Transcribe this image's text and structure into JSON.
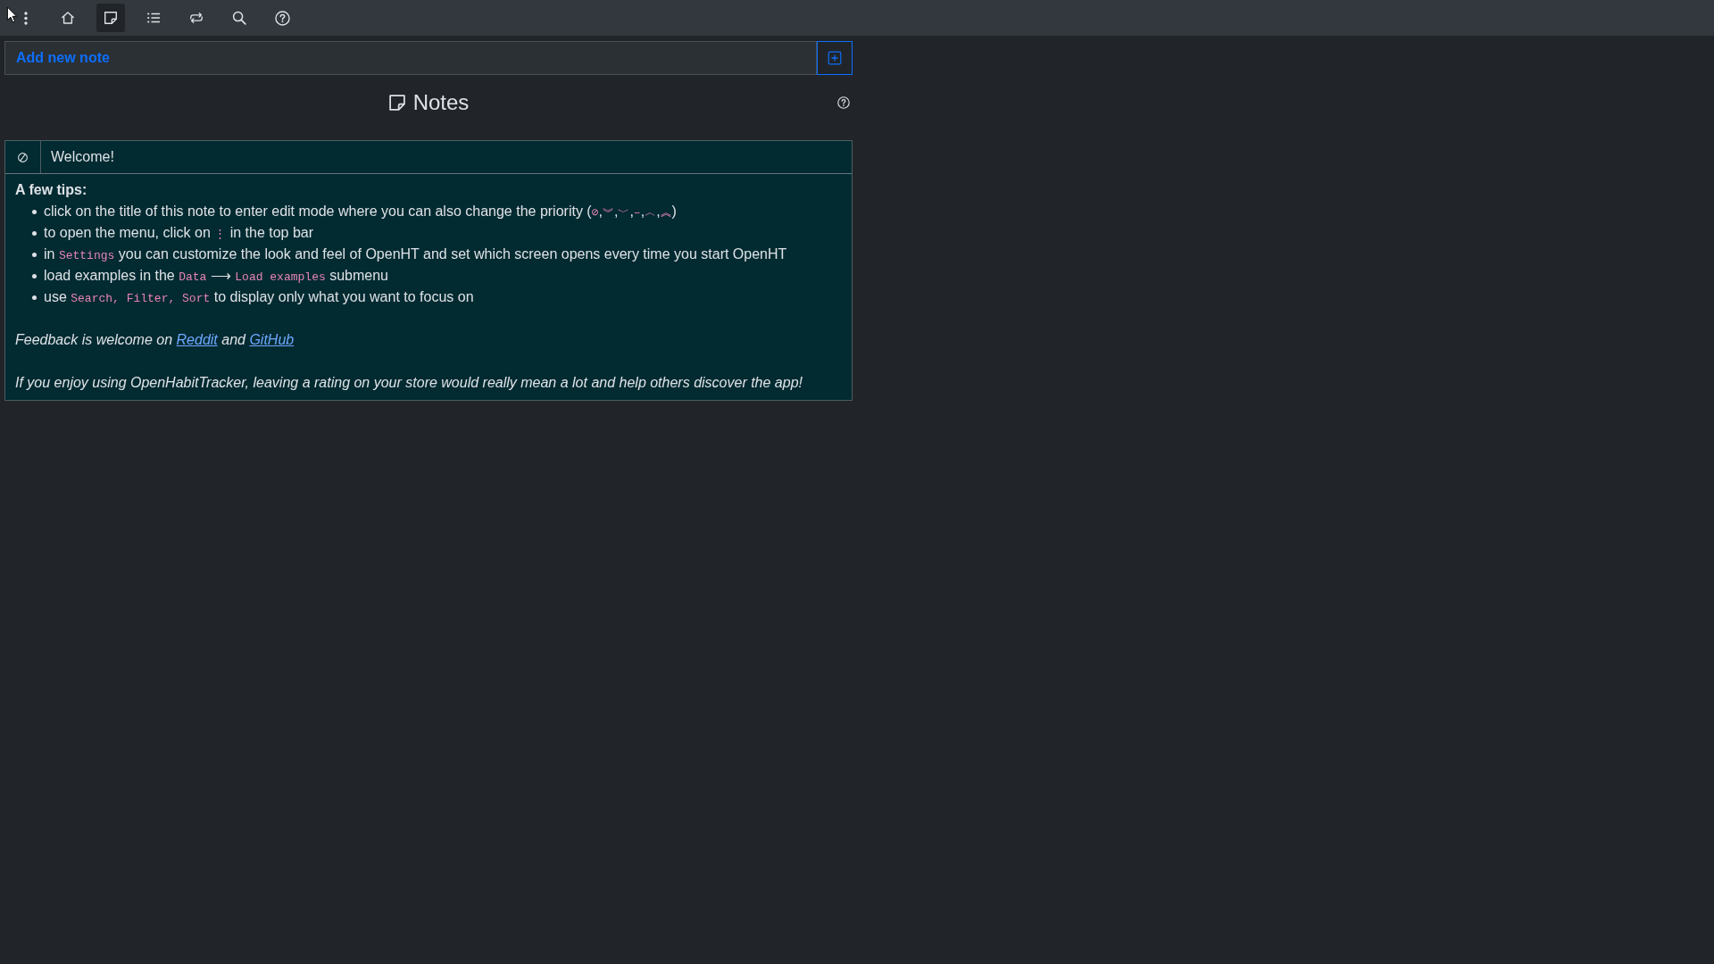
{
  "top_bar": {
    "nav": [
      {
        "kind": "home",
        "selected": false
      },
      {
        "kind": "notes",
        "selected": true
      },
      {
        "kind": "list",
        "selected": false
      },
      {
        "kind": "repeat",
        "selected": false
      },
      {
        "kind": "search",
        "selected": false
      },
      {
        "kind": "help",
        "selected": false
      }
    ]
  },
  "add_note": {
    "placeholder": "Add new note"
  },
  "page": {
    "title": "Notes"
  },
  "notes": [
    {
      "kind": "unprioritized",
      "title": "Welcome!",
      "content": [
        {
          "kind": "heading",
          "text": "A few tips:"
        },
        {
          "kind": "bullets",
          "items": [
            {
              "parts": [
                {
                  "kind": "text",
                  "text": "click on the title of this note to enter edit mode where you can also change the priority ("
                },
                {
                  "kind": "code",
                  "text": "⊘"
                },
                {
                  "kind": "text",
                  "text": ","
                },
                {
                  "kind": "code",
                  "text": "︾"
                },
                {
                  "kind": "text",
                  "text": ","
                },
                {
                  "kind": "code",
                  "text": "﹀"
                },
                {
                  "kind": "text",
                  "text": ","
                },
                {
                  "kind": "code",
                  "text": "–"
                },
                {
                  "kind": "text",
                  "text": ","
                },
                {
                  "kind": "code",
                  "text": "︿"
                },
                {
                  "kind": "text",
                  "text": ","
                },
                {
                  "kind": "code",
                  "text": "︽"
                },
                {
                  "kind": "text",
                  "text": ")"
                }
              ]
            },
            {
              "parts": [
                {
                  "kind": "text",
                  "text": "to open the menu, click on "
                },
                {
                  "kind": "code",
                  "text": "⋮"
                },
                {
                  "kind": "text",
                  "text": " in the top bar"
                }
              ]
            },
            {
              "parts": [
                {
                  "kind": "text",
                  "text": "in "
                },
                {
                  "kind": "code",
                  "text": "Settings"
                },
                {
                  "kind": "text",
                  "text": " you can customize the look and feel of OpenHT and set which screen opens every time you start OpenHT"
                }
              ]
            },
            {
              "parts": [
                {
                  "kind": "text",
                  "text": "load examples in the "
                },
                {
                  "kind": "code",
                  "text": "Data"
                },
                {
                  "kind": "text",
                  "text": " ⟶ "
                },
                {
                  "kind": "code",
                  "text": "Load examples"
                },
                {
                  "kind": "text",
                  "text": " submenu"
                }
              ]
            },
            {
              "parts": [
                {
                  "kind": "text",
                  "text": "use "
                },
                {
                  "kind": "code",
                  "text": "Search, Filter, Sort"
                },
                {
                  "kind": "text",
                  "text": " to display only what you want to focus on"
                }
              ]
            }
          ]
        },
        {
          "kind": "emphasis",
          "parts": [
            {
              "kind": "text",
              "text": "Feedback is welcome on "
            },
            {
              "kind": "link",
              "text": "Reddit"
            },
            {
              "kind": "text",
              "text": " and "
            },
            {
              "kind": "link",
              "text": "GitHub"
            }
          ]
        },
        {
          "kind": "emphasis",
          "parts": [
            {
              "kind": "text",
              "text": "If you enjoy using OpenHabitTracker, leaving a rating on your store would really mean a lot and help others discover the app!"
            }
          ]
        }
      ]
    }
  ]
}
